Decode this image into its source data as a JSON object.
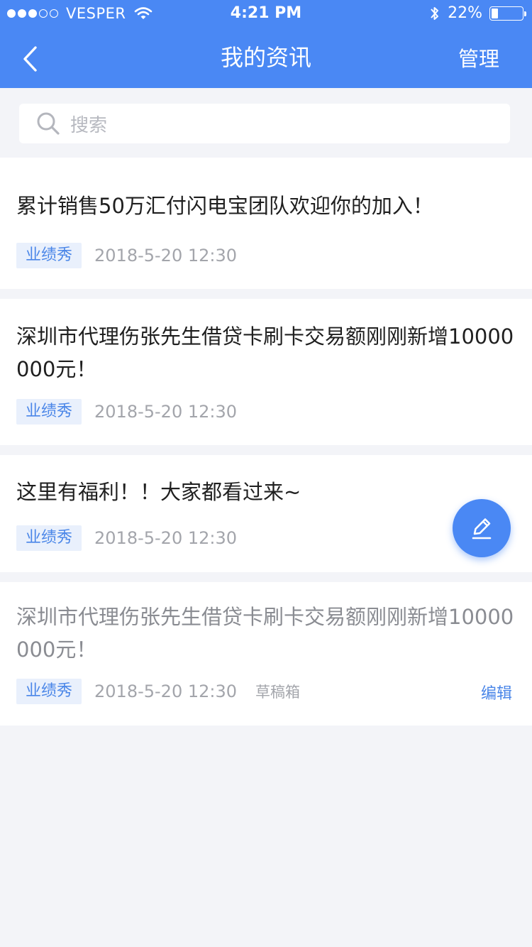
{
  "status_bar": {
    "carrier": "VESPER",
    "time": "4:21 PM",
    "battery": "22%",
    "battery_level": 0.22,
    "icons": [
      "signal-dots-icon",
      "wifi-icon",
      "bluetooth-icon",
      "battery-icon"
    ]
  },
  "nav": {
    "title": "我的资讯",
    "manage_label": "管理",
    "back_icon": "chevron-left-icon"
  },
  "search": {
    "placeholder": "搜索",
    "icon": "search-icon"
  },
  "articles": [
    {
      "title": "累计销售50万汇付闪电宝团队欢迎你的加入！",
      "tag": "业绩秀",
      "time": "2018-5-20 12:30"
    },
    {
      "title": "深圳市代理伤张先生借贷卡刷卡交易额刚刚新增10000000元！",
      "tag": "业绩秀",
      "time": "2018-5-20 12:30"
    },
    {
      "title": "这里有福利！！大家都看过来~",
      "tag": "业绩秀",
      "time": "2018-5-20 12:30"
    },
    {
      "title": "深圳市代理伤张先生借贷卡刷卡交易额刚刚新增10000000元！",
      "tag": "业绩秀",
      "time": "2018-5-20 12:30",
      "draft_label": "草稿箱",
      "edit_label": "编辑"
    }
  ],
  "fab": {
    "icon": "pencil-icon"
  },
  "colors": {
    "primary": "#4a88f4",
    "background": "#f3f4f8",
    "tag_bg": "#e9f0fc",
    "tag_text": "#4a86e8",
    "muted_text": "#a3a5ab"
  }
}
